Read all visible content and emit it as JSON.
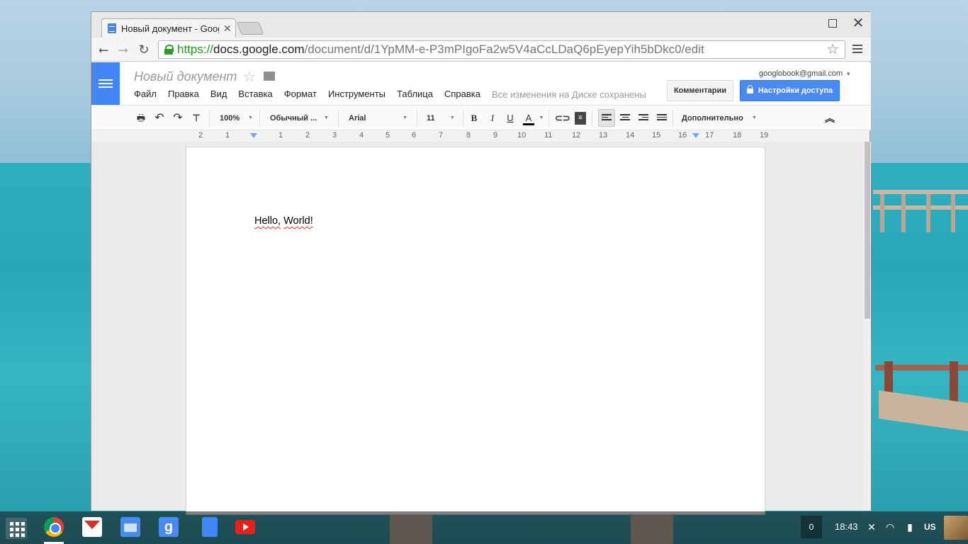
{
  "browser": {
    "tab_title": "Новый документ - Goog",
    "url_scheme": "https://",
    "url_host": "docs.google.com",
    "url_path": "/document/d/1YpMM-e-P3mPIgoFa2w5V4aCcLDaQ6pEyepYih5bDkc0/edit"
  },
  "docs": {
    "title": "Новый документ",
    "menu": [
      "Файл",
      "Правка",
      "Вид",
      "Вставка",
      "Формат",
      "Инструменты",
      "Таблица",
      "Справка"
    ],
    "save_status": "Все изменения на Диске сохранены",
    "account": "googlobook@gmail.com",
    "comments_label": "Комментарии",
    "share_label": "Настройки доступа"
  },
  "format_toolbar": {
    "zoom": "100%",
    "style": "Обычный ...",
    "font": "Arial",
    "size": "11",
    "bold": "B",
    "italic": "I",
    "underline": "U",
    "text_color": "A",
    "more": "Дополнительно"
  },
  "ruler": [
    "2",
    "1",
    "1",
    "2",
    "3",
    "4",
    "5",
    "6",
    "7",
    "8",
    "9",
    "10",
    "11",
    "12",
    "13",
    "14",
    "15",
    "16",
    "17",
    "18",
    "19"
  ],
  "document": {
    "word1": "Hello,",
    "word2": "World!"
  },
  "shelf": {
    "notifications": "0",
    "time": "18:43",
    "input_method": "US"
  },
  "colors": {
    "docs_blue": "#4285f4",
    "share_button": "#4a8af4",
    "url_green": "#1a9f1a"
  }
}
